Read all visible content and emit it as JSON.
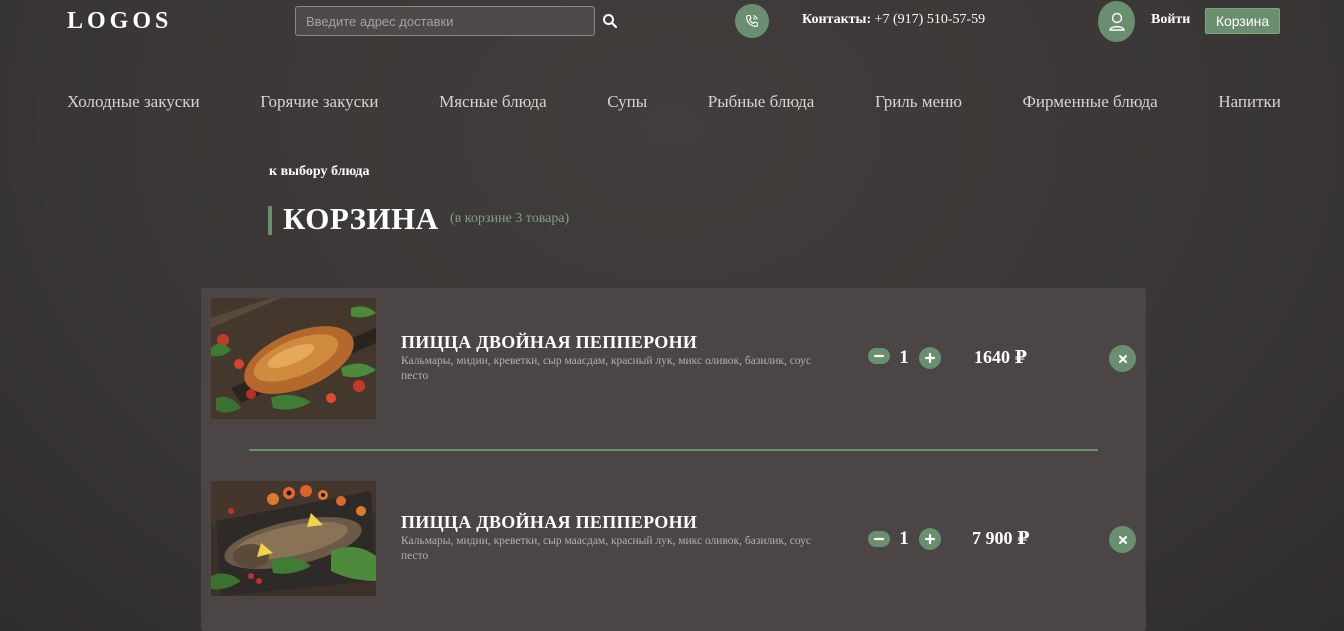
{
  "header": {
    "logo": "LOGOS",
    "search_placeholder": "Введите адрес доставки",
    "contacts_label": "Контакты:",
    "contacts_phone": "+7 (917) 510-57-59",
    "login_label": "Войти",
    "cart_label": "Корзина"
  },
  "nav": {
    "items": [
      "Холодные закуски",
      "Горячие закуски",
      "Мясные блюда",
      "Супы",
      "Рыбные блюда",
      "Гриль меню",
      "Фирменные блюда",
      "Напитки"
    ]
  },
  "page": {
    "back_link": "к выбору блюда",
    "title": "КОРЗИНА",
    "count": "(в корзине 3 товара)"
  },
  "cart": {
    "items": [
      {
        "name": "ПИЦЦА ДВОЙНАЯ ПЕППЕРОНИ",
        "description": "Кальмары, мидии, креветки, сыр маасдам, красный лук, микс оливок, базилик, соус песто",
        "quantity": "1",
        "price": "1640 ₽",
        "image": "roasted-meat-dish"
      },
      {
        "name": "ПИЦЦА ДВОЙНАЯ ПЕППЕРОНИ",
        "description": "Кальмары, мидии, креветки, сыр маасдам, красный лук, микс оливок, базилик, соус песто",
        "quantity": "1",
        "price": "7 900 ₽",
        "image": "baked-fish-dish"
      }
    ]
  },
  "colors": {
    "accent": "#6a8f6e",
    "background": "#3a3736",
    "panel": "#4b4645",
    "count_text": "#7ea283"
  },
  "icons": [
    "search-icon",
    "phone-icon",
    "user-icon",
    "minus-icon",
    "plus-icon",
    "close-icon"
  ]
}
